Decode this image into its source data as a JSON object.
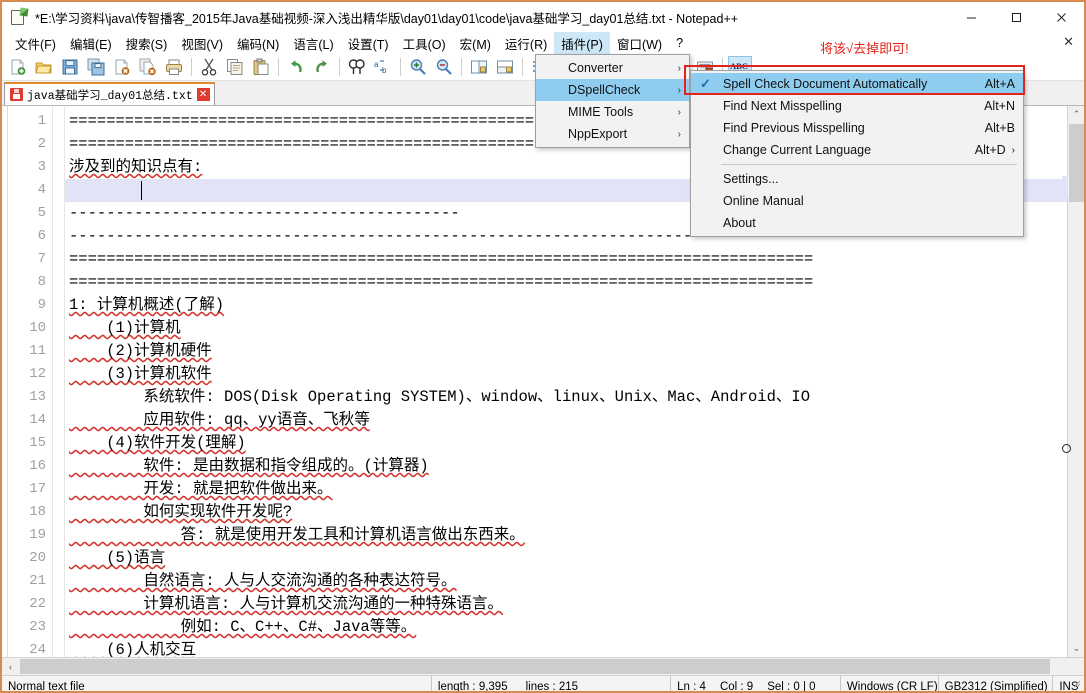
{
  "window": {
    "title": "*E:\\学习资料\\java\\传智播客_2015年Java基础视频-深入浅出精华版\\day01\\day01\\code\\java基础学习_day01总结.txt - Notepad++",
    "app_icon": "notepad-plus-plus-icon",
    "minimize_label": "—",
    "maximize_label": "☐",
    "close_label": "✕"
  },
  "menubar": {
    "items": [
      {
        "label": "文件(F)",
        "name": "menu-file",
        "active": false
      },
      {
        "label": "编辑(E)",
        "name": "menu-edit",
        "active": false
      },
      {
        "label": "搜索(S)",
        "name": "menu-search",
        "active": false
      },
      {
        "label": "视图(V)",
        "name": "menu-view",
        "active": false
      },
      {
        "label": "编码(N)",
        "name": "menu-encoding",
        "active": false
      },
      {
        "label": "语言(L)",
        "name": "menu-language",
        "active": false
      },
      {
        "label": "设置(T)",
        "name": "menu-settings",
        "active": false
      },
      {
        "label": "工具(O)",
        "name": "menu-tools",
        "active": false
      },
      {
        "label": "宏(M)",
        "name": "menu-macro",
        "active": false
      },
      {
        "label": "运行(R)",
        "name": "menu-run",
        "active": false
      },
      {
        "label": "插件(P)",
        "name": "menu-plugins",
        "active": true
      },
      {
        "label": "窗口(W)",
        "name": "menu-window",
        "active": false
      },
      {
        "label": "?",
        "name": "menu-help",
        "active": false
      }
    ],
    "close_document_label": "✕"
  },
  "toolbar": {
    "icons": [
      "new-file-icon",
      "open-file-icon",
      "save-icon",
      "save-all-icon",
      "close-file-icon",
      "close-all-icon",
      "print-icon",
      "cut-icon",
      "copy-icon",
      "paste-icon",
      "undo-icon",
      "redo-icon",
      "find-icon",
      "replace-icon",
      "zoom-in-icon",
      "zoom-out-icon",
      "sync-vertical-scroll-icon",
      "sync-horizontal-scroll-icon",
      "word-wrap-icon",
      "show-all-characters-icon",
      "indent-guide-icon",
      "record-macro-icon",
      "play-macro-icon",
      "run-macro-multiple-icon",
      "run-command-icon",
      "spell-check-abc-icon"
    ],
    "abc_label": "ABC"
  },
  "tab": {
    "label": "java基础学习_day01总结.txt",
    "modified_icon": "unsaved-save-icon",
    "close_icon": "close-tab-icon",
    "close_glyph": "✕"
  },
  "annotation": {
    "text": "将该√去掉即可!",
    "color": "#e2231a"
  },
  "plugin_menu": {
    "items": [
      {
        "label": "Converter",
        "name": "plugin-menu-converter",
        "has_submenu": true,
        "selected": false
      },
      {
        "label": "DSpellCheck",
        "name": "plugin-menu-dspellcheck",
        "has_submenu": true,
        "selected": true
      },
      {
        "label": "MIME Tools",
        "name": "plugin-menu-mime-tools",
        "has_submenu": true,
        "selected": false
      },
      {
        "label": "NppExport",
        "name": "plugin-menu-nppexport",
        "has_submenu": true,
        "selected": false
      }
    ],
    "submenu_arrow": "›"
  },
  "dspell_menu": {
    "items": [
      {
        "label": "Spell Check Document Automatically",
        "accel": "Alt+A",
        "name": "dspell-spell-check-automatically",
        "checked": true,
        "selected": true,
        "submenu": false,
        "separator_before": false
      },
      {
        "label": "Find Next Misspelling",
        "accel": "Alt+N",
        "name": "dspell-find-next-misspelling",
        "checked": false,
        "selected": false,
        "submenu": false,
        "separator_before": false
      },
      {
        "label": "Find Previous Misspelling",
        "accel": "Alt+B",
        "name": "dspell-find-previous-misspelling",
        "checked": false,
        "selected": false,
        "submenu": false,
        "separator_before": false
      },
      {
        "label": "Change Current Language",
        "accel": "Alt+D",
        "name": "dspell-change-current-language",
        "checked": false,
        "selected": false,
        "submenu": true,
        "separator_before": false
      },
      {
        "label": "Settings...",
        "accel": "",
        "name": "dspell-settings",
        "checked": false,
        "selected": false,
        "submenu": false,
        "separator_before": true
      },
      {
        "label": "Online Manual",
        "accel": "",
        "name": "dspell-online-manual",
        "checked": false,
        "selected": false,
        "submenu": false,
        "separator_before": false
      },
      {
        "label": "About",
        "accel": "",
        "name": "dspell-about",
        "checked": false,
        "selected": false,
        "submenu": false,
        "separator_before": false
      }
    ],
    "check_glyph": "✓",
    "submenu_arrow": "›"
  },
  "editor": {
    "current_line": 4,
    "lines": [
      {
        "n": 1,
        "text": "================================================================================",
        "spell": false
      },
      {
        "n": 2,
        "text": "================================================================================",
        "spell": false
      },
      {
        "n": 3,
        "text": "涉及到的知识点有:",
        "spell": true
      },
      {
        "n": 4,
        "text": "",
        "spell": false
      },
      {
        "n": 5,
        "text": "------------------------------------------",
        "spell": false
      },
      {
        "n": 6,
        "text": "-------------------------------------------------------------------------------",
        "spell": false
      },
      {
        "n": 7,
        "text": "================================================================================",
        "spell": false
      },
      {
        "n": 8,
        "text": "================================================================================",
        "spell": false
      },
      {
        "n": 9,
        "text": "1: 计算机概述(了解)",
        "spell": true
      },
      {
        "n": 10,
        "text": "    (1)计算机",
        "spell": true
      },
      {
        "n": 11,
        "text": "    (2)计算机硬件",
        "spell": true
      },
      {
        "n": 12,
        "text": "    (3)计算机软件",
        "spell": true
      },
      {
        "n": 13,
        "text": "        系统软件: DOS(Disk Operating SYSTEM)、window、linux、Unix、Mac、Android、IO",
        "spell": false
      },
      {
        "n": 14,
        "text": "        应用软件: qq、yy语音、飞秋等",
        "spell": true
      },
      {
        "n": 15,
        "text": "    (4)软件开发(理解)",
        "spell": true
      },
      {
        "n": 16,
        "text": "        软件: 是由数据和指令组成的。(计算器)",
        "spell": true
      },
      {
        "n": 17,
        "text": "        开发: 就是把软件做出来。",
        "spell": true
      },
      {
        "n": 18,
        "text": "        如何实现软件开发呢?",
        "spell": true
      },
      {
        "n": 19,
        "text": "            答: 就是使用开发工具和计算机语言做出东西来。",
        "spell": true
      },
      {
        "n": 20,
        "text": "    (5)语言",
        "spell": true
      },
      {
        "n": 21,
        "text": "        自然语言: 人与人交流沟通的各种表达符号。",
        "spell": true
      },
      {
        "n": 22,
        "text": "        计算机语言: 人与计算机交流沟通的一种特殊语言。",
        "spell": true
      },
      {
        "n": 23,
        "text": "            例如: C、C++、C#、Java等等。",
        "spell": true
      },
      {
        "n": 24,
        "text": "    (6)人机交互",
        "spell": true
      }
    ]
  },
  "scrollbars": {
    "v_up_glyph": "⌃",
    "v_down_glyph": "⌄",
    "h_left_glyph": "‹",
    "h_right_glyph": "›"
  },
  "statusbar": {
    "file_type": "Normal text file",
    "length_label": "length : 9,395",
    "lines_label": "lines : 215",
    "ln_label": "Ln : 4",
    "col_label": "Col : 9",
    "sel_label": "Sel : 0 | 0",
    "eol": "Windows (CR LF)",
    "encoding": "GB2312 (Simplified)",
    "insert_mode": "INS"
  }
}
